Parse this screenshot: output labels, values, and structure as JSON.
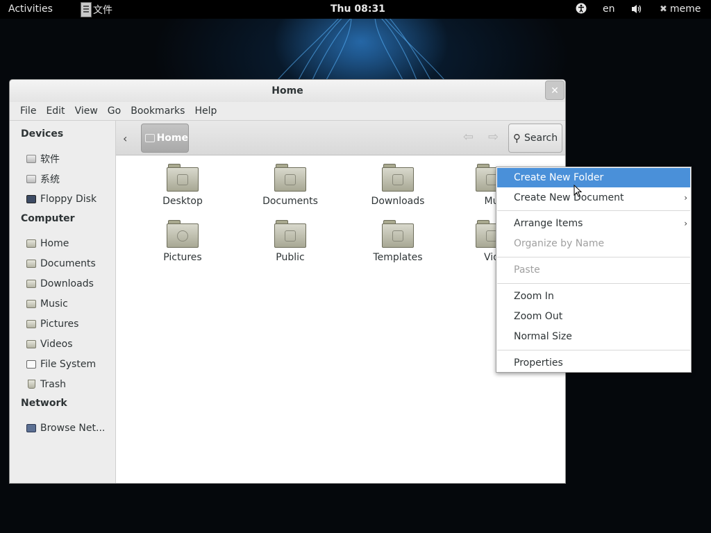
{
  "topbar": {
    "activities": "Activities",
    "app_name": "文件",
    "clock": "Thu 08:31",
    "accessibility_icon": "accessibility-icon",
    "language": "en",
    "volume_icon": "volume-icon",
    "user": "meme"
  },
  "window": {
    "title": "Home",
    "close_glyph": "✕"
  },
  "menubar": [
    "File",
    "Edit",
    "View",
    "Go",
    "Bookmarks",
    "Help"
  ],
  "sidebar": {
    "devices_heading": "Devices",
    "devices": [
      {
        "label": "软件",
        "icon": "disk-icon"
      },
      {
        "label": "系统",
        "icon": "disk-icon"
      },
      {
        "label": "Floppy Disk",
        "icon": "floppy-icon"
      }
    ],
    "computer_heading": "Computer",
    "computer": [
      {
        "label": "Home",
        "icon": "home-folder-icon"
      },
      {
        "label": "Documents",
        "icon": "documents-folder-icon"
      },
      {
        "label": "Downloads",
        "icon": "downloads-folder-icon"
      },
      {
        "label": "Music",
        "icon": "music-folder-icon"
      },
      {
        "label": "Pictures",
        "icon": "pictures-folder-icon"
      },
      {
        "label": "Videos",
        "icon": "videos-folder-icon"
      },
      {
        "label": "File System",
        "icon": "filesystem-icon"
      },
      {
        "label": "Trash",
        "icon": "trash-icon"
      }
    ],
    "network_heading": "Network",
    "network": [
      {
        "label": "Browse Net...",
        "icon": "network-icon"
      }
    ]
  },
  "toolbar": {
    "breadcrumb": "Home",
    "search_label": "Search"
  },
  "files": [
    {
      "label": "Desktop"
    },
    {
      "label": "Documents"
    },
    {
      "label": "Downloads"
    },
    {
      "label": "Mu"
    },
    {
      "label": "Pictures"
    },
    {
      "label": "Public"
    },
    {
      "label": "Templates"
    },
    {
      "label": "Vid"
    }
  ],
  "context_menu": {
    "create_folder": "Create New Folder",
    "create_document": "Create New Document",
    "arrange_items": "Arrange Items",
    "organize_by_name": "Organize by Name",
    "paste": "Paste",
    "zoom_in": "Zoom In",
    "zoom_out": "Zoom Out",
    "normal_size": "Normal Size",
    "properties": "Properties",
    "highlight_color": "#4a90d9"
  }
}
